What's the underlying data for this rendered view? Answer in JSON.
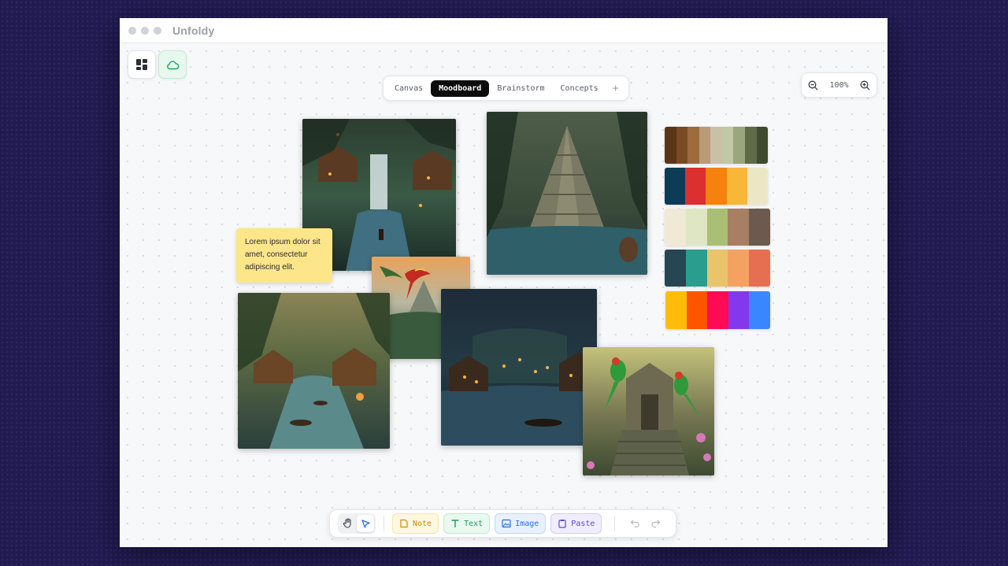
{
  "app": {
    "title": "Unfoldy"
  },
  "tabs": [
    {
      "label": "Canvas",
      "active": false
    },
    {
      "label": "Moodboard",
      "active": true
    },
    {
      "label": "Brainstorm",
      "active": false
    },
    {
      "label": "Concepts",
      "active": false
    }
  ],
  "tabs_add": "+",
  "zoom": {
    "level": "100%"
  },
  "sticky_note": {
    "text": "Lorem ipsum dolor sit amet, consectetur adipiscing elit."
  },
  "palettes": [
    [
      "#5a3618",
      "#7a4a24",
      "#9c6b3e",
      "#b99b78",
      "#c9c0a8",
      "#c1c7a7",
      "#9aa67e",
      "#5e6b46",
      "#3f4a30"
    ],
    [
      "#0e3b56",
      "#dc2f2f",
      "#f5820d",
      "#f8b739",
      "#ede6c5"
    ],
    [
      "#efe9d6",
      "#dfe6c3",
      "#a9bf73",
      "#a77f63",
      "#6b5a4d"
    ],
    [
      "#264653",
      "#2a9d8f",
      "#e9c46a",
      "#f4a261",
      "#e76f51"
    ],
    [
      "#ffbd0a",
      "#ff5400",
      "#ff0a54",
      "#8338ec",
      "#3a86ff"
    ]
  ],
  "images": [
    {
      "name": "waterfall-village-image"
    },
    {
      "name": "jungle-temple-image"
    },
    {
      "name": "parrot-pyramid-image"
    },
    {
      "name": "river-village-image"
    },
    {
      "name": "night-village-image"
    },
    {
      "name": "parrot-shrine-image"
    }
  ],
  "bottom_toolbar": {
    "note_label": "Note",
    "text_label": "Text",
    "image_label": "Image",
    "paste_label": "Paste"
  },
  "colors": {
    "background": "#211b52",
    "sticky": "#fde68a",
    "active_tab": "#0c0c0c"
  },
  "icons": [
    "layout-grid-icon",
    "cloud-icon",
    "zoom-out-icon",
    "zoom-in-icon",
    "hand-icon",
    "pointer-icon",
    "note-icon",
    "text-icon",
    "image-icon",
    "paste-icon",
    "undo-icon",
    "redo-icon"
  ]
}
